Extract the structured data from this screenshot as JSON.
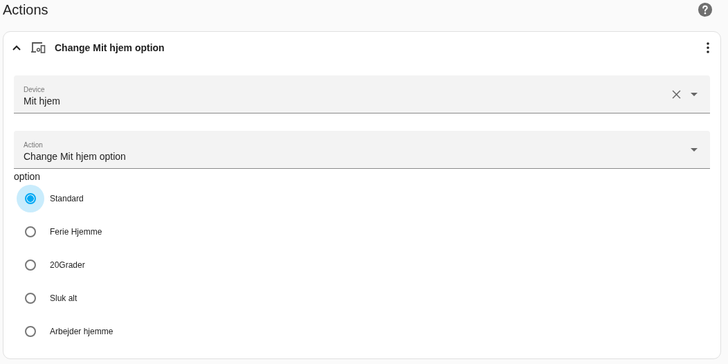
{
  "page": {
    "title": "Actions"
  },
  "action_card": {
    "title": "Change Mit hjem option",
    "expanded": true,
    "fields": [
      {
        "label": "Device",
        "value": "Mit hjem",
        "clearable": true
      },
      {
        "label": "Action",
        "value": "Change Mit hjem option",
        "clearable": false
      }
    ],
    "option_group": {
      "label": "option",
      "options": [
        {
          "label": "Standard",
          "selected": true
        },
        {
          "label": "Ferie Hjemme",
          "selected": false
        },
        {
          "label": "20Grader",
          "selected": false
        },
        {
          "label": "Sluk alt",
          "selected": false
        },
        {
          "label": "Arbejder hjemme",
          "selected": false
        }
      ]
    }
  }
}
